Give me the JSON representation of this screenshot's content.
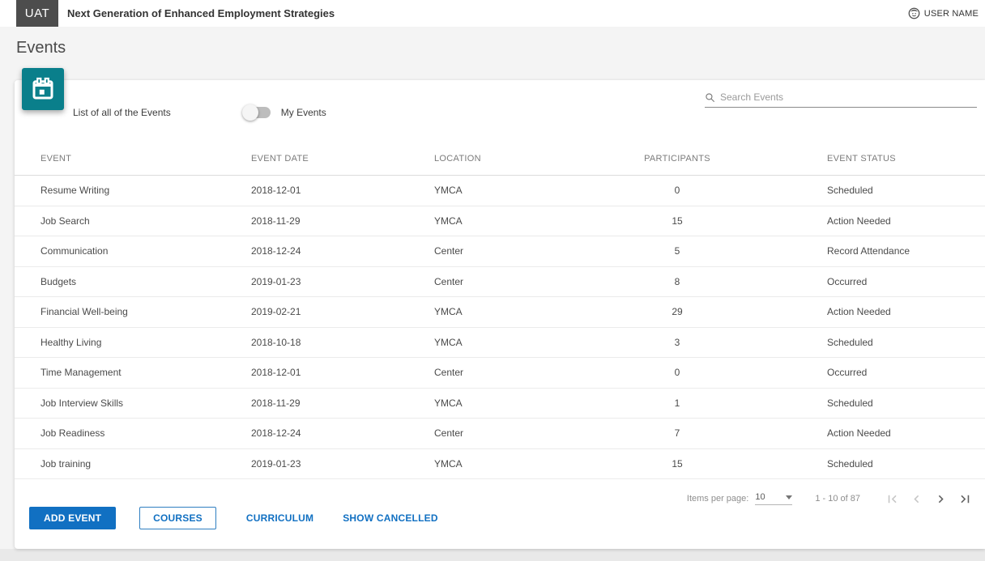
{
  "header": {
    "badge": "UAT",
    "title": "Next Generation of Enhanced Employment Strategies",
    "user_name": "USER NAME"
  },
  "page": {
    "title": "Events"
  },
  "toolbar": {
    "subtitle": "List of all of the Events",
    "my_events_label": "My Events",
    "my_events_on": false,
    "search_placeholder": "Search Events"
  },
  "table": {
    "columns": [
      "EVENT",
      "EVENT DATE",
      "LOCATION",
      "PARTICIPANTS",
      "EVENT STATUS"
    ],
    "rows": [
      {
        "event": "Resume Writing",
        "date": "2018-12-01",
        "location": "YMCA",
        "participants": "0",
        "status": "Scheduled"
      },
      {
        "event": "Job Search",
        "date": "2018-11-29",
        "location": "YMCA",
        "participants": "15",
        "status": "Action Needed"
      },
      {
        "event": "Communication",
        "date": "2018-12-24",
        "location": "Center",
        "participants": "5",
        "status": "Record Attendance"
      },
      {
        "event": "Budgets",
        "date": "2019-01-23",
        "location": "Center",
        "participants": "8",
        "status": "Occurred"
      },
      {
        "event": "Financial Well-being",
        "date": "2019-02-21",
        "location": "YMCA",
        "participants": "29",
        "status": "Action Needed"
      },
      {
        "event": "Healthy Living",
        "date": "2018-10-18",
        "location": "YMCA",
        "participants": "3",
        "status": "Scheduled"
      },
      {
        "event": "Time Management",
        "date": "2018-12-01",
        "location": "Center",
        "participants": "0",
        "status": "Occurred"
      },
      {
        "event": "Job Interview Skills",
        "date": "2018-11-29",
        "location": "YMCA",
        "participants": "1",
        "status": "Scheduled"
      },
      {
        "event": "Job Readiness",
        "date": "2018-12-24",
        "location": "Center",
        "participants": "7",
        "status": "Action Needed"
      },
      {
        "event": "Job training",
        "date": "2019-01-23",
        "location": "YMCA",
        "participants": "15",
        "status": "Scheduled"
      }
    ]
  },
  "footer": {
    "buttons": [
      {
        "label": "ADD EVENT",
        "style": "primary"
      },
      {
        "label": "COURSES",
        "style": "outlined"
      },
      {
        "label": "CURRICULUM",
        "style": "text"
      },
      {
        "label": "SHOW CANCELLED",
        "style": "text"
      }
    ],
    "paginator": {
      "items_per_page_label": "Items per page:",
      "page_size": "10",
      "range_label": "1 - 10 of 87",
      "first_disabled": true,
      "prev_disabled": true,
      "next_disabled": false,
      "last_disabled": false
    }
  },
  "icons": {
    "user": "account-circle-icon",
    "calendar": "calendar-icon",
    "search": "search-icon",
    "dropdown": "dropdown-arrow-icon",
    "first": "first-page-icon",
    "prev": "chevron-left-icon",
    "next": "chevron-right-icon",
    "last": "last-page-icon"
  },
  "colors": {
    "teal_accent": "#0a7f8b",
    "primary_blue": "#1170c2",
    "badge_gray": "#4d4d4d",
    "card_bg": "#ffffff",
    "band_bg": "#f4f4f4"
  }
}
